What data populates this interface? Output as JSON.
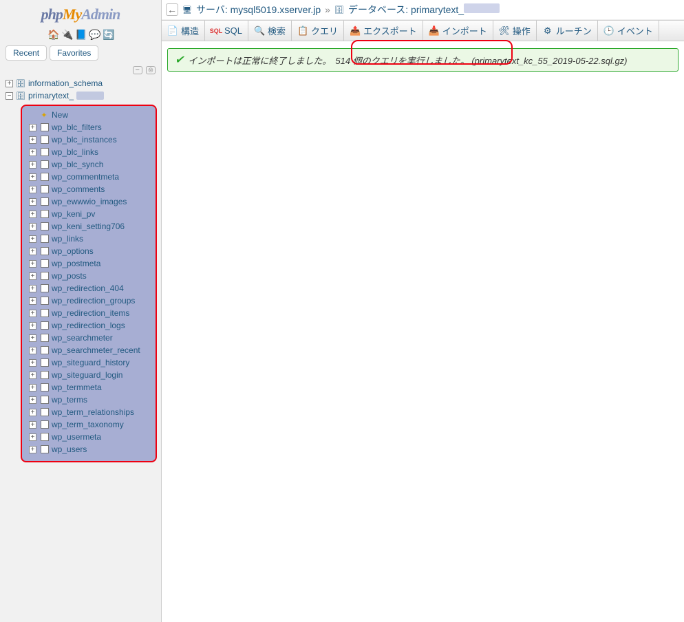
{
  "logo": {
    "php": "php",
    "my": "My",
    "admin": "Admin"
  },
  "sidebar_tabs": {
    "recent": "Recent",
    "favorites": "Favorites"
  },
  "databases": [
    {
      "name": "information_schema",
      "expanded": false
    },
    {
      "name": "primarytext_",
      "expanded": true
    }
  ],
  "new_label": "New",
  "tables": [
    "wp_blc_filters",
    "wp_blc_instances",
    "wp_blc_links",
    "wp_blc_synch",
    "wp_commentmeta",
    "wp_comments",
    "wp_ewwwio_images",
    "wp_keni_pv",
    "wp_keni_setting706",
    "wp_links",
    "wp_options",
    "wp_postmeta",
    "wp_posts",
    "wp_redirection_404",
    "wp_redirection_groups",
    "wp_redirection_items",
    "wp_redirection_logs",
    "wp_searchmeter",
    "wp_searchmeter_recent",
    "wp_siteguard_history",
    "wp_siteguard_login",
    "wp_termmeta",
    "wp_terms",
    "wp_term_relationships",
    "wp_term_taxonomy",
    "wp_usermeta",
    "wp_users"
  ],
  "breadcrumb": {
    "server_label": "サーバ:",
    "server_value": "mysql5019.xserver.jp",
    "sep": "»",
    "db_label": "データベース:",
    "db_value": "primarytext_"
  },
  "toolbar": [
    {
      "icon": "📄",
      "label": "構造",
      "name": "structure"
    },
    {
      "icon": "🔲",
      "label": "SQL",
      "name": "sql",
      "icon_text": "SQL",
      "icon_color": "#d33"
    },
    {
      "icon": "🔍",
      "label": "検索",
      "name": "search"
    },
    {
      "icon": "📋",
      "label": "クエリ",
      "name": "query"
    },
    {
      "icon": "📤",
      "label": "エクスポート",
      "name": "export"
    },
    {
      "icon": "📥",
      "label": "インポート",
      "name": "import"
    },
    {
      "icon": "🛠",
      "label": "操作",
      "name": "operations"
    },
    {
      "icon": "⚙",
      "label": "ルーチン",
      "name": "routines"
    },
    {
      "icon": "🕒",
      "label": "イベント",
      "name": "events"
    }
  ],
  "message": {
    "text_left": "インポートは正常に終了しました。",
    "text_right": "514 個のクエリを実行しました。 (primarytext_kc_55_2019-05-22.sql.gz)"
  }
}
